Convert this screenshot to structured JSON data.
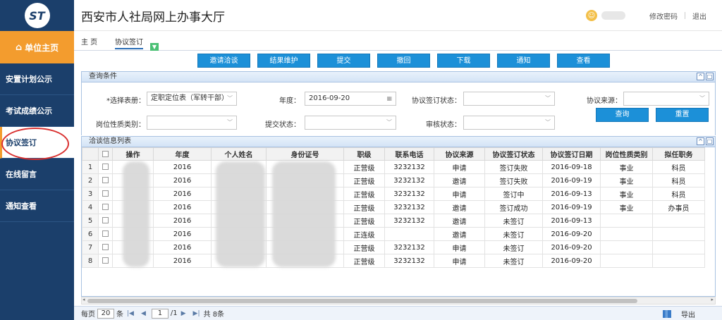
{
  "app": {
    "title": "西安市人社局网上办事大厅",
    "logo_text": "ST"
  },
  "header": {
    "change_password": "修改密码",
    "logout": "退出"
  },
  "sidebar": {
    "home": "单位主页",
    "items": [
      {
        "label": "安置计划公示"
      },
      {
        "label": "考试成绩公示"
      },
      {
        "label": "协议签订"
      },
      {
        "label": "在线留言"
      },
      {
        "label": "通知查看"
      }
    ]
  },
  "tabs": [
    {
      "label": "主 页"
    },
    {
      "label": "协议签订"
    }
  ],
  "toolbar": {
    "buttons": [
      "邀请洽谈",
      "结果维护",
      "提交",
      "撤回",
      "下载",
      "通知",
      "查看"
    ]
  },
  "query": {
    "panel_title": "查询条件",
    "labels": {
      "table_select": "*选择表册：",
      "year": "年度：",
      "agreement_status": "协议签订状态：",
      "agreement_source": "协议来源：",
      "post_nature": "岗位性质类别：",
      "submit_status": "提交状态：",
      "review_status": "审核状态："
    },
    "values": {
      "table_select": "定职定位表（军转干部）",
      "year": "2016-09-20"
    },
    "search_button": "查询",
    "reset_button": "重置"
  },
  "list": {
    "panel_title": "洽谈信息列表",
    "columns": [
      "操作",
      "年度",
      "个人姓名",
      "身份证号",
      "职级",
      "联系电话",
      "协议来源",
      "协议签订状态",
      "协议签订日期",
      "岗位性质类别",
      "拟任职务"
    ],
    "rows": [
      {
        "n": "1",
        "year": "2016",
        "rank": "正营级",
        "phone": "3232132",
        "source": "申请",
        "status": "签订失败",
        "date": "2016-09-18",
        "nature": "事业",
        "post": "科员"
      },
      {
        "n": "2",
        "year": "2016",
        "rank": "正营级",
        "phone": "3232132",
        "source": "邀请",
        "status": "签订失败",
        "date": "2016-09-19",
        "nature": "事业",
        "post": "科员"
      },
      {
        "n": "3",
        "year": "2016",
        "rank": "正营级",
        "phone": "3232132",
        "source": "申请",
        "status": "签订中",
        "date": "2016-09-13",
        "nature": "事业",
        "post": "科员"
      },
      {
        "n": "4",
        "year": "2016",
        "rank": "正营级",
        "phone": "3232132",
        "source": "邀请",
        "status": "签订成功",
        "date": "2016-09-19",
        "nature": "事业",
        "post": "办事员"
      },
      {
        "n": "5",
        "year": "2016",
        "rank": "正营级",
        "phone": "3232132",
        "source": "邀请",
        "status": "未签订",
        "date": "2016-09-13",
        "nature": "",
        "post": ""
      },
      {
        "n": "6",
        "year": "2016",
        "rank": "正连级",
        "phone": "",
        "source": "邀请",
        "status": "未签订",
        "date": "2016-09-20",
        "nature": "",
        "post": ""
      },
      {
        "n": "7",
        "year": "2016",
        "rank": "正营级",
        "phone": "3232132",
        "source": "申请",
        "status": "未签订",
        "date": "2016-09-20",
        "nature": "",
        "post": ""
      },
      {
        "n": "8",
        "year": "2016",
        "rank": "正营级",
        "phone": "3232132",
        "source": "申请",
        "status": "未签订",
        "date": "2016-09-20",
        "nature": "",
        "post": ""
      }
    ]
  },
  "pager": {
    "per_page_label": "每页",
    "per_page": "20",
    "per_page_unit": "条",
    "page": "1",
    "page_total": "/1",
    "total": "共 8条",
    "export": "导出"
  }
}
